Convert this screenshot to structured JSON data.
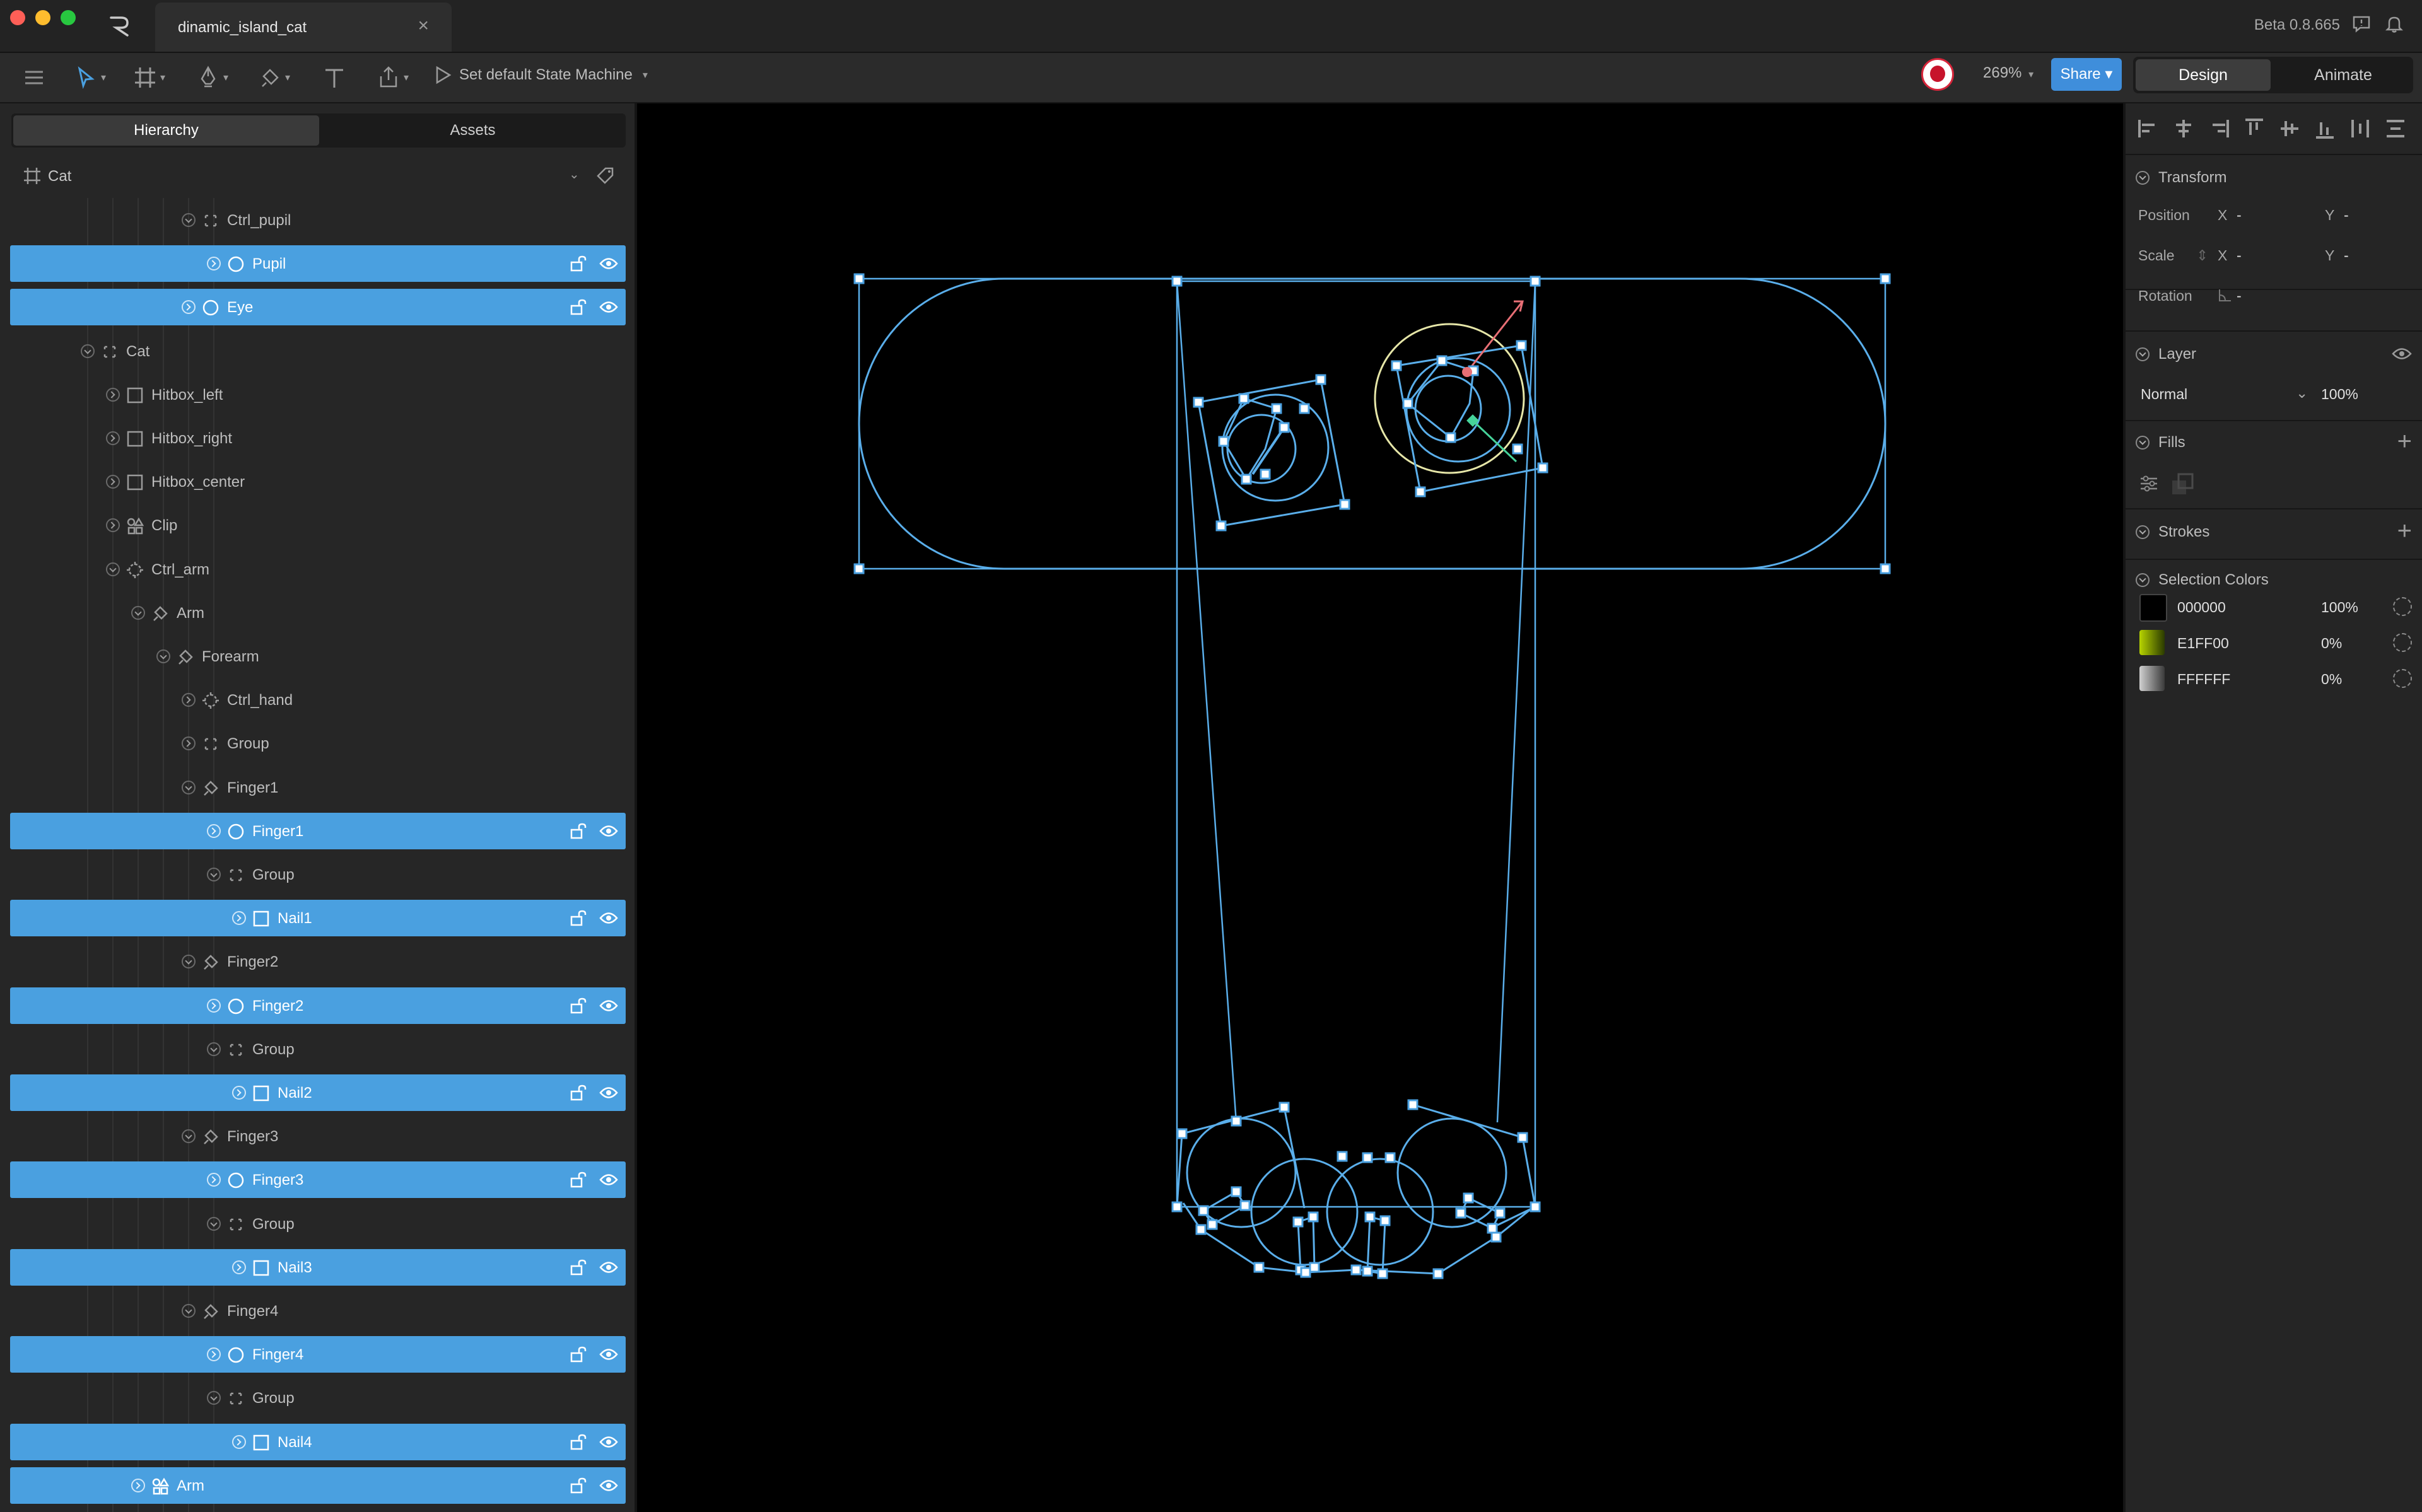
{
  "window": {
    "tab_title": "dinamic_island_cat",
    "version": "Beta 0.8.665",
    "icons": [
      "rive-logo-icon",
      "close-icon",
      "feedback-icon",
      "bell-icon"
    ]
  },
  "toolbar": {
    "state_machine_label": "Set default State Machine",
    "zoom": "269%",
    "share_label": "Share",
    "mode_design": "Design",
    "mode_animate": "Animate",
    "icons": [
      "menu-icon",
      "select-tool-icon",
      "artboard-tool-icon",
      "pen-tool-icon",
      "bone-tool-icon",
      "text-tool-icon",
      "export-icon",
      "play-icon"
    ]
  },
  "left": {
    "tab_hierarchy": "Hierarchy",
    "tab_assets": "Assets",
    "artboard": "Cat",
    "rows": [
      {
        "label": "Ctrl_pupil",
        "sel": false,
        "indent": 6,
        "icon": "group-icon",
        "open": true
      },
      {
        "label": "Pupil",
        "sel": true,
        "indent": 7,
        "icon": "ellipse-icon",
        "open": false
      },
      {
        "label": "Eye",
        "sel": true,
        "indent": 6,
        "icon": "ellipse-icon",
        "open": false
      },
      {
        "label": "Cat",
        "sel": false,
        "indent": 2,
        "icon": "group-icon",
        "open": true
      },
      {
        "label": "Hitbox_left",
        "sel": false,
        "indent": 3,
        "icon": "rect-icon",
        "open": false
      },
      {
        "label": "Hitbox_right",
        "sel": false,
        "indent": 3,
        "icon": "rect-icon",
        "open": false
      },
      {
        "label": "Hitbox_center",
        "sel": false,
        "indent": 3,
        "icon": "rect-icon",
        "open": false
      },
      {
        "label": "Clip",
        "sel": false,
        "indent": 3,
        "icon": "shapes-icon",
        "open": false
      },
      {
        "label": "Ctrl_arm",
        "sel": false,
        "indent": 3,
        "icon": "target-icon",
        "open": true
      },
      {
        "label": "Arm",
        "sel": false,
        "indent": 4,
        "icon": "bone-icon",
        "open": true
      },
      {
        "label": "Forearm",
        "sel": false,
        "indent": 5,
        "icon": "bone-icon",
        "open": true
      },
      {
        "label": "Ctrl_hand",
        "sel": false,
        "indent": 6,
        "icon": "target-icon",
        "open": false
      },
      {
        "label": "Group",
        "sel": false,
        "indent": 6,
        "icon": "group-icon",
        "open": false
      },
      {
        "label": "Finger1",
        "sel": false,
        "indent": 6,
        "icon": "bone-icon",
        "open": true
      },
      {
        "label": "Finger1",
        "sel": true,
        "indent": 7,
        "icon": "ellipse-icon",
        "open": false
      },
      {
        "label": "Group",
        "sel": false,
        "indent": 7,
        "icon": "group-icon",
        "open": true
      },
      {
        "label": "Nail1",
        "sel": true,
        "indent": 8,
        "icon": "rect-icon",
        "open": false
      },
      {
        "label": "Finger2",
        "sel": false,
        "indent": 6,
        "icon": "bone-icon",
        "open": true
      },
      {
        "label": "Finger2",
        "sel": true,
        "indent": 7,
        "icon": "ellipse-icon",
        "open": false
      },
      {
        "label": "Group",
        "sel": false,
        "indent": 7,
        "icon": "group-icon",
        "open": true
      },
      {
        "label": "Nail2",
        "sel": true,
        "indent": 8,
        "icon": "rect-icon",
        "open": false
      },
      {
        "label": "Finger3",
        "sel": false,
        "indent": 6,
        "icon": "bone-icon",
        "open": true
      },
      {
        "label": "Finger3",
        "sel": true,
        "indent": 7,
        "icon": "ellipse-icon",
        "open": false
      },
      {
        "label": "Group",
        "sel": false,
        "indent": 7,
        "icon": "group-icon",
        "open": true
      },
      {
        "label": "Nail3",
        "sel": true,
        "indent": 8,
        "icon": "rect-icon",
        "open": false
      },
      {
        "label": "Finger4",
        "sel": false,
        "indent": 6,
        "icon": "bone-icon",
        "open": true
      },
      {
        "label": "Finger4",
        "sel": true,
        "indent": 7,
        "icon": "ellipse-icon",
        "open": false
      },
      {
        "label": "Group",
        "sel": false,
        "indent": 7,
        "icon": "group-icon",
        "open": true
      },
      {
        "label": "Nail4",
        "sel": true,
        "indent": 8,
        "icon": "rect-icon",
        "open": false
      },
      {
        "label": "Arm",
        "sel": true,
        "indent": 4,
        "icon": "shapes-icon",
        "open": false
      }
    ]
  },
  "right": {
    "transform": {
      "title": "Transform",
      "position_label": "Position",
      "scale_label": "Scale",
      "rotation_label": "Rotation",
      "x_label": "X",
      "y_label": "Y",
      "empty_value": "-"
    },
    "layer": {
      "title": "Layer",
      "blend_mode": "Normal",
      "opacity": "100%"
    },
    "fills": {
      "title": "Fills"
    },
    "strokes": {
      "title": "Strokes"
    },
    "selection_colors": {
      "title": "Selection Colors",
      "items": [
        {
          "hex": "000000",
          "opacity": "100%",
          "swatch": "#000000"
        },
        {
          "hex": "E1FF00",
          "opacity": "0%",
          "swatch": "#b7d400"
        },
        {
          "hex": "FFFFFF",
          "opacity": "0%",
          "swatch": "#9a9a9a"
        }
      ]
    }
  },
  "colors": {
    "accent": "#4aa0e0",
    "selection_line": "#5aaeea"
  }
}
